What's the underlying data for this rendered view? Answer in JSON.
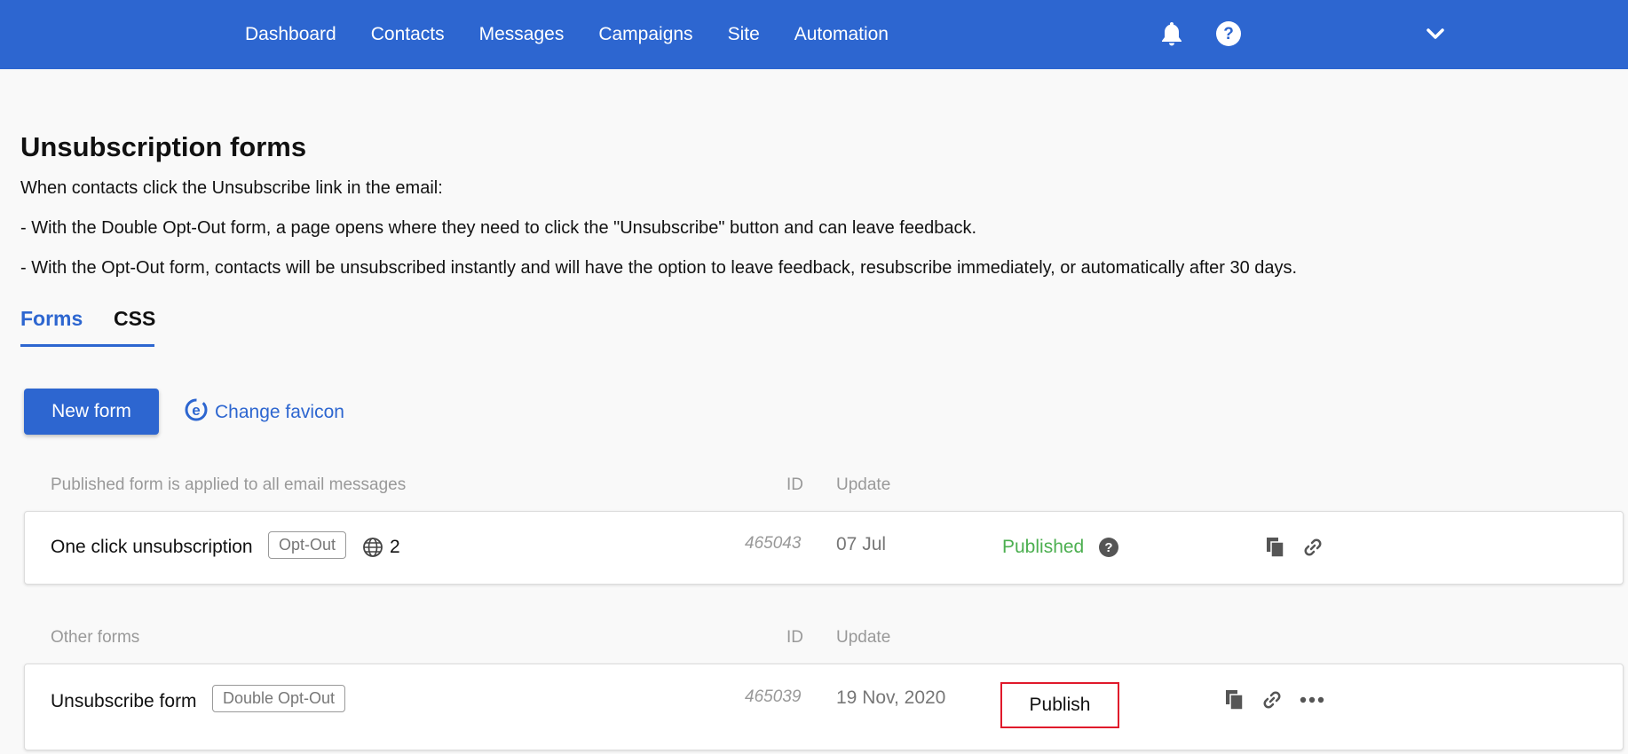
{
  "nav": {
    "items": [
      "Dashboard",
      "Contacts",
      "Messages",
      "Campaigns",
      "Site",
      "Automation"
    ]
  },
  "page": {
    "title": "Unsubscription forms",
    "intro": "When contacts click the Unsubscribe link in the email:",
    "line1": "- With the Double Opt-Out form, a page opens where they need to click the \"Unsubscribe\" button and can leave feedback.",
    "line2": "- With the Opt-Out form, contacts will be unsubscribed instantly and will have the option to leave feedback, resubscribe immediately, or automatically after 30 days."
  },
  "tabs": {
    "forms": "Forms",
    "css": "CSS"
  },
  "actions": {
    "new_form": "New form",
    "change_favicon": "Change favicon"
  },
  "published_section": {
    "header": "Published form is applied to all email messages",
    "id_header": "ID",
    "update_header": "Update",
    "form": {
      "name": "One click unsubscription",
      "tag": "Opt-Out",
      "sites_count": "2",
      "id": "465043",
      "update": "07 Jul",
      "status": "Published"
    }
  },
  "other_section": {
    "header": "Other forms",
    "id_header": "ID",
    "update_header": "Update",
    "form": {
      "name": "Unsubscribe form",
      "tag": "Double Opt-Out",
      "id": "465039",
      "update": "19 Nov, 2020",
      "publish_label": "Publish"
    }
  },
  "colors": {
    "brand": "#2d66d0",
    "published": "#4caf50",
    "highlight": "#e0192b"
  },
  "icons": [
    "bell-icon",
    "help-icon",
    "chevron-down-icon",
    "favicon-icon",
    "globe-icon",
    "copy-icon",
    "link-icon",
    "more-icon"
  ]
}
